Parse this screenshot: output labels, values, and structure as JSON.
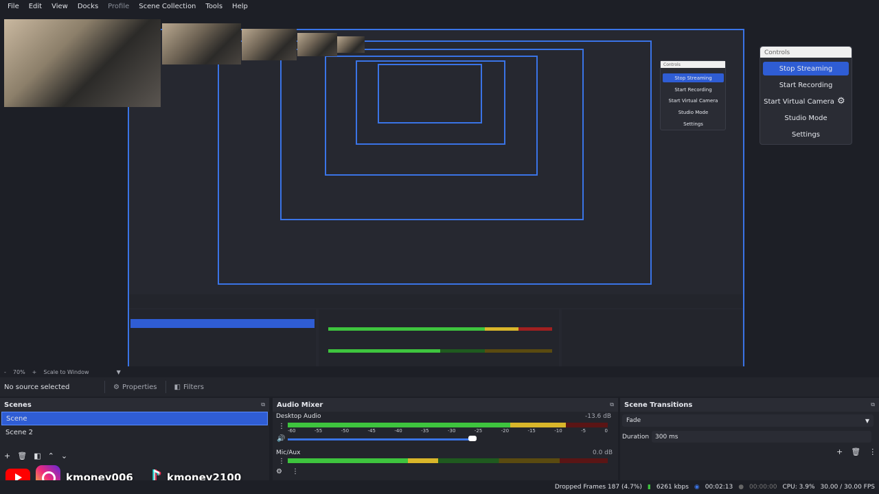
{
  "menu": [
    "File",
    "Edit",
    "View",
    "Docks",
    "Profile",
    "Scene Collection",
    "Tools",
    "Help"
  ],
  "controls": {
    "title": "Controls",
    "buttons": [
      "Stop Streaming",
      "Start Recording",
      "Start Virtual Camera",
      "Studio Mode",
      "Settings"
    ]
  },
  "zoom": {
    "percent": "70%",
    "plus": "+",
    "minus": "-",
    "mode": "Scale to Window"
  },
  "source_toolbar": {
    "no_source": "No source selected",
    "properties": "Properties",
    "filters": "Filters"
  },
  "scenes": {
    "title": "Scenes",
    "items": [
      "Scene",
      "Scene 2"
    ],
    "selected": 0
  },
  "mixer": {
    "title": "Audio Mixer",
    "channels": [
      {
        "name": "Desktop Audio",
        "db": "-13.6 dB",
        "level": 0.87
      },
      {
        "name": "Mic/Aux",
        "db": "0.0 dB",
        "level": 0.47
      }
    ],
    "scale": [
      "-60",
      "-55",
      "-50",
      "-45",
      "-40",
      "-35",
      "-30",
      "-25",
      "-20",
      "-15",
      "-10",
      "-5",
      "0"
    ]
  },
  "transitions": {
    "title": "Scene Transitions",
    "selected": "Fade",
    "duration_label": "Duration",
    "duration_value": "300 ms"
  },
  "social": {
    "handle1": "kmoney006",
    "handle2": "kmoney2100"
  },
  "status": {
    "dropped": "Dropped Frames 187 (4.7%)",
    "bitrate": "6261 kbps",
    "stream_time": "00:02:13",
    "rec_time": "00:00:00",
    "cpu": "CPU: 3.9%",
    "fps": "30.00 / 30.00 FPS"
  },
  "colors": {
    "accent": "#2f5dd4",
    "border": "#3a74e7",
    "bg": "#1d1f26"
  }
}
